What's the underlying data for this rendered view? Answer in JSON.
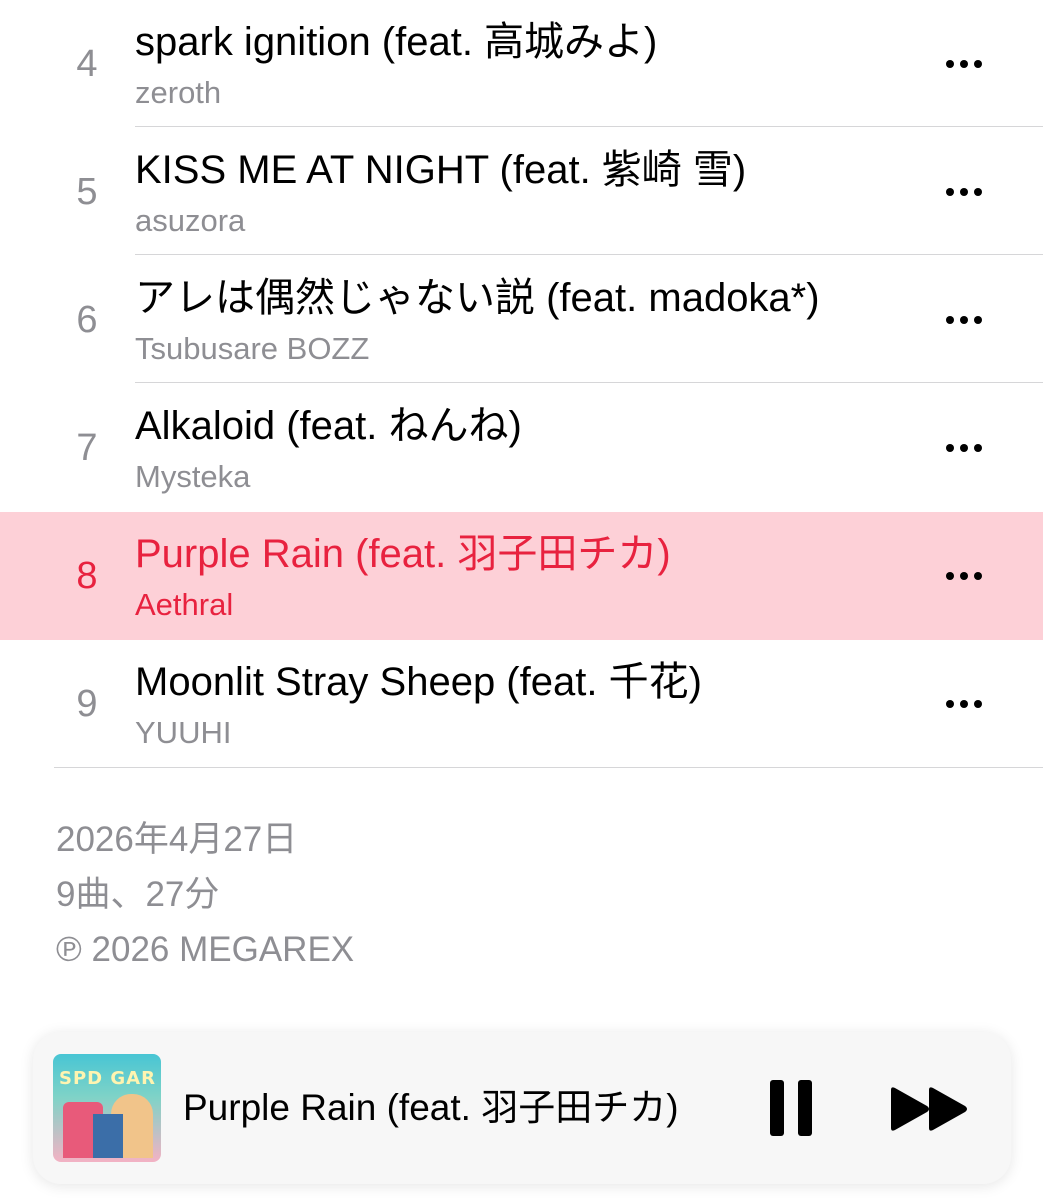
{
  "tracks": [
    {
      "number": "4",
      "title": "spark ignition (feat. 高城みよ)",
      "artist": "zeroth",
      "active": false
    },
    {
      "number": "5",
      "title": "KISS ME AT NIGHT (feat. 紫崎 雪)",
      "artist": "asuzora",
      "active": false
    },
    {
      "number": "6",
      "title": "アレは偶然じゃない説 (feat. madoka*)",
      "artist": "Tsubusare BOZZ",
      "active": false
    },
    {
      "number": "7",
      "title": "Alkaloid (feat. ねんね)",
      "artist": "Mysteka",
      "active": false
    },
    {
      "number": "8",
      "title": "Purple Rain (feat. 羽子田チカ)",
      "artist": "Aethral",
      "active": true
    },
    {
      "number": "9",
      "title": "Moonlit Stray Sheep (feat. 千花)",
      "artist": "YUUHI",
      "active": false
    }
  ],
  "album_info": {
    "release_date": "2026年4月27日",
    "summary": "9曲、27分",
    "copyright": "℗ 2026 MEGAREX"
  },
  "player": {
    "now_playing_title": "Purple Rain (feat. 羽子田チカ)",
    "artwork_text": "SPD GAR",
    "state": "playing"
  },
  "colors": {
    "accent": "#e8223f",
    "active_row_bg": "#fdd0d7",
    "secondary_text": "#8e8e93"
  }
}
